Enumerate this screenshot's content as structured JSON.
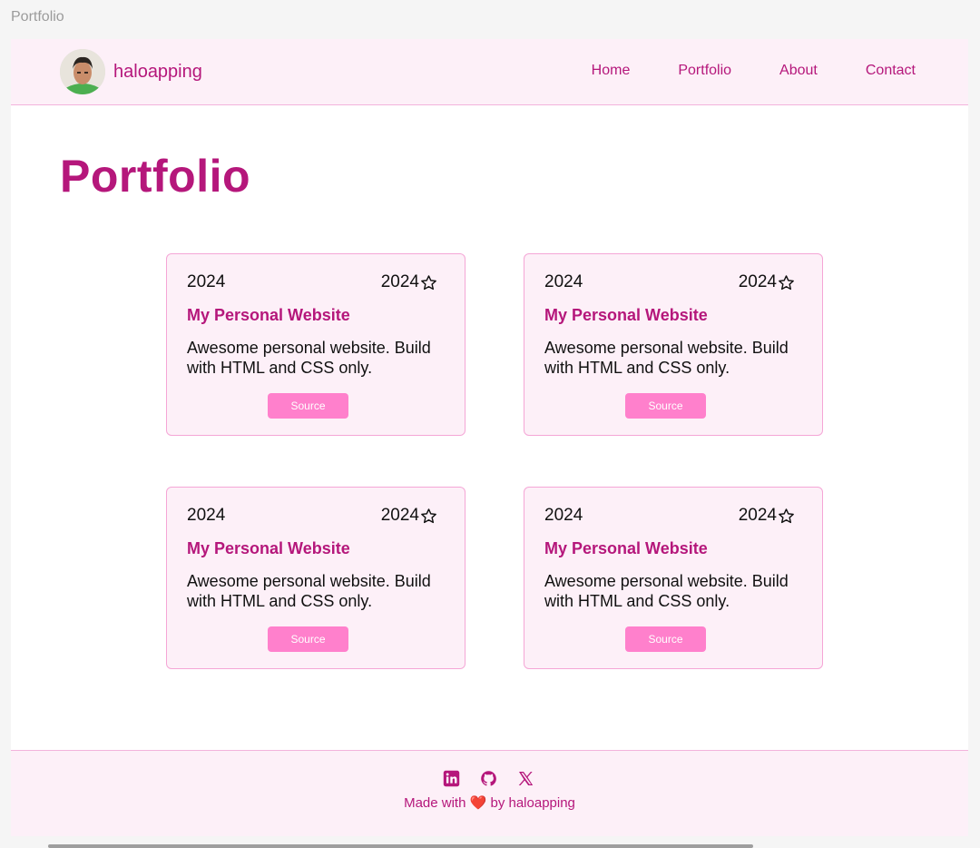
{
  "window": {
    "title": "Portfolio"
  },
  "header": {
    "brand_name": "haloapping",
    "nav": [
      {
        "label": "Home"
      },
      {
        "label": "Portfolio"
      },
      {
        "label": "About"
      },
      {
        "label": "Contact"
      }
    ]
  },
  "main": {
    "title": "Portfolio",
    "cards": [
      {
        "year": "2024",
        "stars": "2024",
        "title": "My Personal Website",
        "description": "Awesome personal website. Build with HTML and CSS only.",
        "button": "Source"
      },
      {
        "year": "2024",
        "stars": "2024",
        "title": "My Personal Website",
        "description": "Awesome personal website. Build with HTML and CSS only.",
        "button": "Source"
      },
      {
        "year": "2024",
        "stars": "2024",
        "title": "My Personal Website",
        "description": "Awesome personal website. Build with HTML and CSS only.",
        "button": "Source"
      },
      {
        "year": "2024",
        "stars": "2024",
        "title": "My Personal Website",
        "description": "Awesome personal website. Build with HTML and CSS only.",
        "button": "Source"
      }
    ]
  },
  "footer": {
    "icons": [
      "linkedin-icon",
      "github-icon",
      "x-icon"
    ],
    "made_with": "Made with",
    "heart": "❤️",
    "by": "by haloapping"
  },
  "colors": {
    "accent": "#b5177b",
    "surface": "#fdf0f8",
    "button": "#ff80cc",
    "border": "#f5a6d6"
  }
}
